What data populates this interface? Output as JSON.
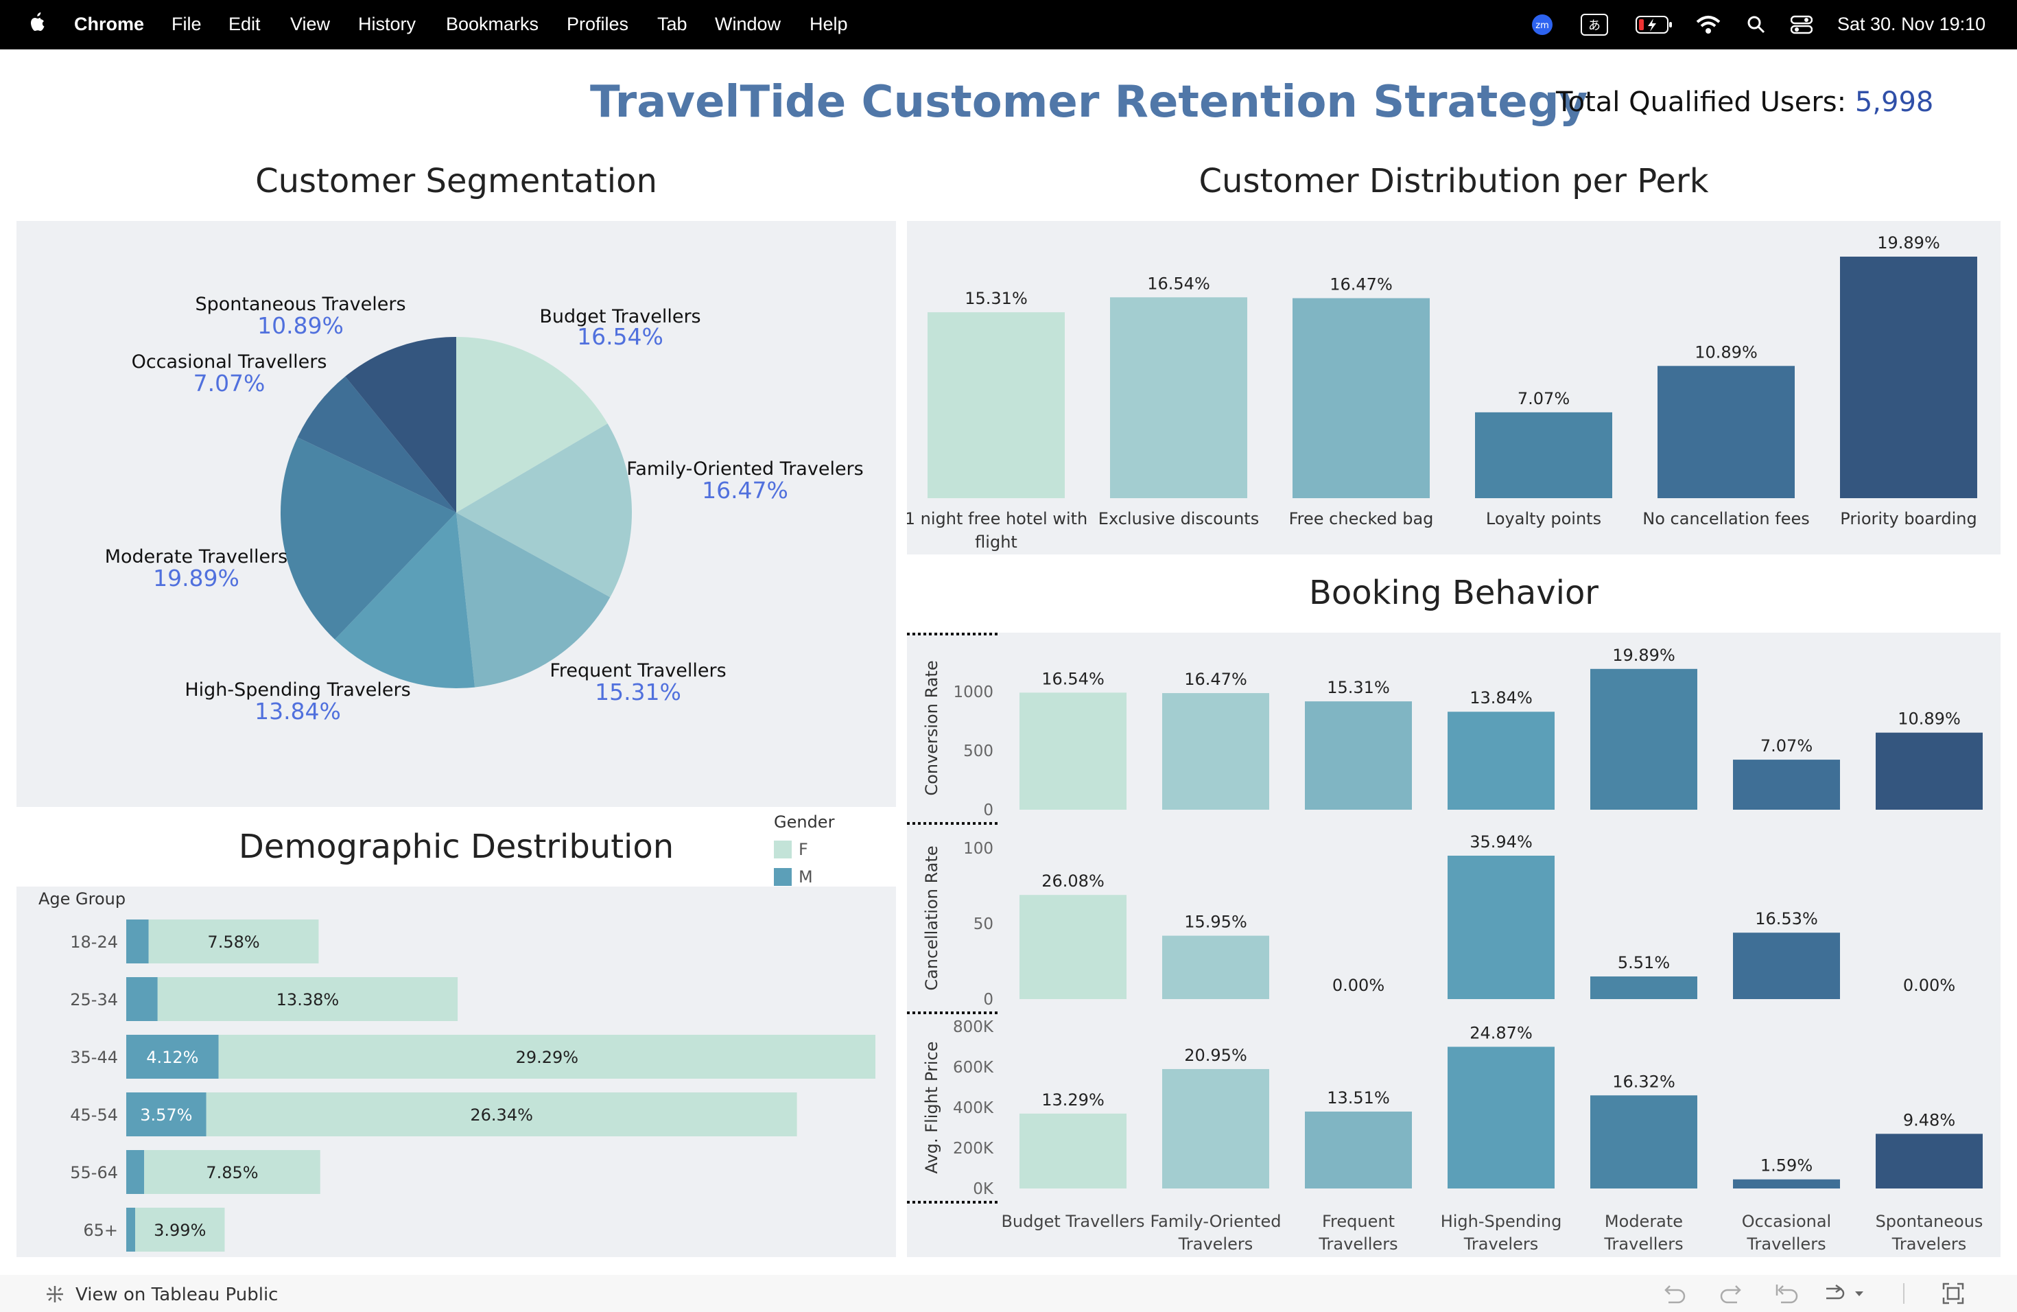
{
  "menubar": {
    "app": "Chrome",
    "items": [
      "File",
      "Edit",
      "View",
      "History",
      "Bookmarks",
      "Profiles",
      "Tab",
      "Window",
      "Help"
    ],
    "zoom_badge": "zm",
    "ime_label": "あ",
    "datetime": "Sat 30. Nov  19:10"
  },
  "dashboard": {
    "title": "TravelTide Customer Retention Strategy",
    "total_label": "Total Qualified Users: ",
    "total_value": "5,998"
  },
  "segmentation": {
    "title": "Customer Segmentation",
    "slices": [
      {
        "name": "Budget Travellers",
        "pct": "16.54%",
        "value": 16.54,
        "color": "#c3e3d8"
      },
      {
        "name": "Family-Oriented Travelers",
        "pct": "16.47%",
        "value": 16.47,
        "color": "#a3cdd0"
      },
      {
        "name": "Frequent Travellers",
        "pct": "15.31%",
        "value": 15.31,
        "color": "#80b5c3"
      },
      {
        "name": "High-Spending Travelers",
        "pct": "13.84%",
        "value": 13.84,
        "color": "#5c9fb8"
      },
      {
        "name": "Moderate Travellers",
        "pct": "19.89%",
        "value": 19.89,
        "color": "#4a85a5"
      },
      {
        "name": "Occasional Travellers",
        "pct": "7.07%",
        "value": 7.07,
        "color": "#3f6f96"
      },
      {
        "name": "Spontaneous Travelers",
        "pct": "10.89%",
        "value": 10.89,
        "color": "#34567f"
      }
    ]
  },
  "perk": {
    "title": "Customer Distribution per Perk",
    "bars": [
      {
        "label1": "1 night free hotel with",
        "label2": "flight",
        "pct": "15.31%",
        "value": 15.31,
        "color": "#c3e3d8"
      },
      {
        "label1": "Exclusive discounts",
        "label2": "",
        "pct": "16.54%",
        "value": 16.54,
        "color": "#a3cdd0"
      },
      {
        "label1": "Free checked bag",
        "label2": "",
        "pct": "16.47%",
        "value": 16.47,
        "color": "#80b5c3"
      },
      {
        "label1": "Loyalty points",
        "label2": "",
        "pct": "7.07%",
        "value": 7.07,
        "color": "#4a85a5"
      },
      {
        "label1": "No cancellation fees",
        "label2": "",
        "pct": "10.89%",
        "value": 10.89,
        "color": "#3f6f96"
      },
      {
        "label1": "Priority boarding",
        "label2": "",
        "pct": "19.89%",
        "value": 19.89,
        "color": "#34567f"
      }
    ]
  },
  "demographic": {
    "title": "Demographic Destribution",
    "axis_label": "Age Group",
    "legend_title": "Gender",
    "legend_f": "F",
    "legend_m": "M",
    "color_f": "#c3e3d8",
    "color_m": "#5c9fb8",
    "rows": [
      {
        "age": "18-24",
        "m": 1.0,
        "m_label": "",
        "f": 7.58,
        "f_label": "7.58%"
      },
      {
        "age": "25-34",
        "m": 1.4,
        "m_label": "",
        "f": 13.38,
        "f_label": "13.38%"
      },
      {
        "age": "35-44",
        "m": 4.12,
        "m_label": "4.12%",
        "f": 29.29,
        "f_label": "29.29%"
      },
      {
        "age": "45-54",
        "m": 3.57,
        "m_label": "3.57%",
        "f": 26.34,
        "f_label": "26.34%"
      },
      {
        "age": "55-64",
        "m": 0.8,
        "m_label": "",
        "f": 7.85,
        "f_label": "7.85%"
      },
      {
        "age": "65+",
        "m": 0.4,
        "m_label": "",
        "f": 3.99,
        "f_label": "3.99%"
      }
    ]
  },
  "booking": {
    "title": "Booking Behavior",
    "categories": [
      {
        "l1": "Budget Travellers",
        "l2": "",
        "color": "#c3e3d8"
      },
      {
        "l1": "Family-Oriented",
        "l2": "Travelers",
        "color": "#a3cdd0"
      },
      {
        "l1": "Frequent",
        "l2": "Travellers",
        "color": "#80b5c3"
      },
      {
        "l1": "High-Spending",
        "l2": "Travelers",
        "color": "#5c9fb8"
      },
      {
        "l1": "Moderate",
        "l2": "Travellers",
        "color": "#4a85a5"
      },
      {
        "l1": "Occasional",
        "l2": "Travellers",
        "color": "#3f6f96"
      },
      {
        "l1": "Spontaneous",
        "l2": "Travelers",
        "color": "#34567f"
      }
    ],
    "rows": [
      {
        "axis": "Conversion Rate",
        "ticks": [
          "1000",
          "500",
          "0"
        ],
        "tick_values": [
          1000,
          500,
          0
        ],
        "max": 1000,
        "values": [
          992,
          988,
          918,
          830,
          1193,
          424,
          653
        ],
        "labels": [
          "16.54%",
          "16.47%",
          "15.31%",
          "13.84%",
          "19.89%",
          "7.07%",
          "10.89%"
        ]
      },
      {
        "axis": "Cancellation Rate",
        "ticks": [
          "100",
          "50",
          "0"
        ],
        "tick_values": [
          100,
          50,
          0
        ],
        "max": 100,
        "values": [
          69,
          42,
          0,
          95,
          15,
          44,
          0
        ],
        "labels": [
          "26.08%",
          "15.95%",
          "0.00%",
          "35.94%",
          "5.51%",
          "16.53%",
          "0.00%"
        ]
      },
      {
        "axis": "Avg. Flight Price",
        "ticks": [
          "800K",
          "600K",
          "400K",
          "200K",
          "0K"
        ],
        "tick_values": [
          800,
          600,
          400,
          200,
          0
        ],
        "max": 800,
        "values": [
          370,
          590,
          380,
          700,
          460,
          45,
          270
        ],
        "labels": [
          "13.29%",
          "20.95%",
          "13.51%",
          "24.87%",
          "16.32%",
          "1.59%",
          "9.48%"
        ]
      }
    ]
  },
  "footer": {
    "tableau_link": "View on Tableau Public"
  }
}
